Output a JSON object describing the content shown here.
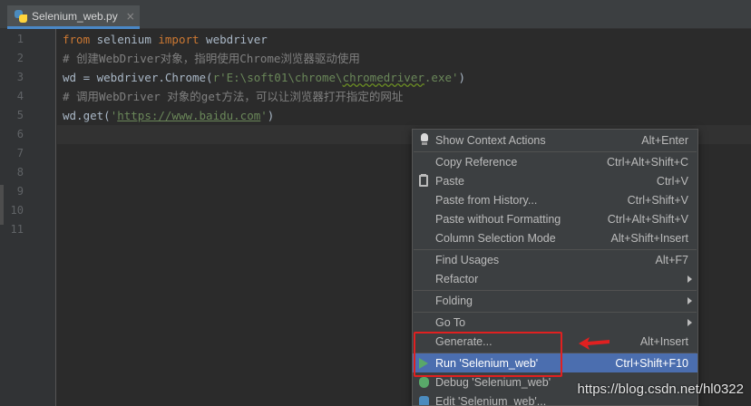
{
  "tab": {
    "filename": "Selenium_web.py",
    "close": "×"
  },
  "gutter": {
    "line_numbers": [
      "1",
      "2",
      "3",
      "4",
      "5",
      "6",
      "7",
      "8",
      "9",
      "10",
      "11"
    ]
  },
  "code": {
    "l1_kw1": "from",
    "l1_mod": " selenium ",
    "l1_kw2": "import",
    "l1_name": " webdriver",
    "l2_comment": "# 创建WebDriver对象，指明使用Chrome浏览器驱动使用",
    "l3_prefix": "wd = webdriver.Chrome(",
    "l3_str_a": "r'E:\\soft01\\chrome\\",
    "l3_str_b": "chromedriver",
    "l3_str_c": ".exe'",
    "l3_suffix": ")",
    "l4_comment": "# 调用WebDriver 对象的get方法，可以让浏览器打开指定的网址",
    "l5_prefix": "wd.get(",
    "l5_q1": "'",
    "l5_url": "https://www.baidu.com",
    "l5_q2": "'",
    "l5_suffix": ")"
  },
  "menu": {
    "show_context_actions": {
      "label": "Show Context Actions",
      "shortcut": "Alt+Enter"
    },
    "copy_reference": {
      "label": "Copy Reference",
      "shortcut": "Ctrl+Alt+Shift+C"
    },
    "paste": {
      "label": "Paste",
      "shortcut": "Ctrl+V"
    },
    "paste_history": {
      "label": "Paste from History...",
      "shortcut": "Ctrl+Shift+V"
    },
    "paste_no_format": {
      "label": "Paste without Formatting",
      "shortcut": "Ctrl+Alt+Shift+V"
    },
    "column_selection": {
      "label": "Column Selection Mode",
      "shortcut": "Alt+Shift+Insert"
    },
    "find_usages": {
      "label": "Find Usages",
      "shortcut": "Alt+F7"
    },
    "refactor": {
      "label": "Refactor"
    },
    "folding": {
      "label": "Folding"
    },
    "go_to": {
      "label": "Go To"
    },
    "generate": {
      "label": "Generate...",
      "shortcut": "Alt+Insert"
    },
    "run": {
      "label": "Run 'Selenium_web'",
      "shortcut": "Ctrl+Shift+F10"
    },
    "debug": {
      "label": "Debug 'Selenium_web'"
    },
    "edit": {
      "label": "Edit 'Selenium_web'..."
    }
  },
  "watermark": "https://blog.csdn.net/hl0322",
  "colors": {
    "editor_bg": "#2b2b2b",
    "menu_bg": "#3c3f41",
    "selection": "#4b6eaf",
    "keyword": "#cc7832",
    "comment": "#808080",
    "string": "#6a8759",
    "annotation_red": "#e02020"
  }
}
